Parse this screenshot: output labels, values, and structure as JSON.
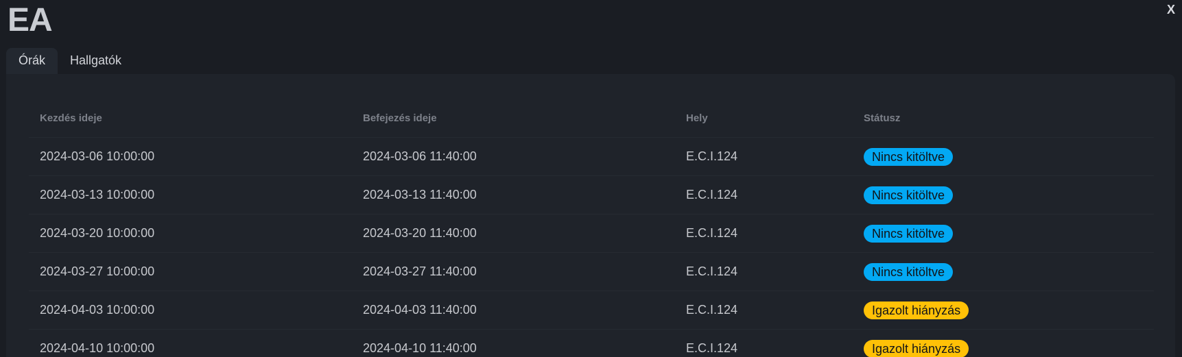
{
  "window": {
    "title": "EA",
    "close_label": "X"
  },
  "tabs": [
    {
      "label": "Órák",
      "active": true
    },
    {
      "label": "Hallgatók",
      "active": false
    }
  ],
  "table": {
    "headers": [
      "Kezdés ideje",
      "Befejezés ideje",
      "Hely",
      "Státusz"
    ],
    "rows": [
      {
        "start": "2024-03-06 10:00:00",
        "end": "2024-03-06 11:40:00",
        "place": "E.C.I.124",
        "status": "Nincs kitöltve",
        "status_color": "#03a9f4"
      },
      {
        "start": "2024-03-13 10:00:00",
        "end": "2024-03-13 11:40:00",
        "place": "E.C.I.124",
        "status": "Nincs kitöltve",
        "status_color": "#03a9f4"
      },
      {
        "start": "2024-03-20 10:00:00",
        "end": "2024-03-20 11:40:00",
        "place": "E.C.I.124",
        "status": "Nincs kitöltve",
        "status_color": "#03a9f4"
      },
      {
        "start": "2024-03-27 10:00:00",
        "end": "2024-03-27 11:40:00",
        "place": "E.C.I.124",
        "status": "Nincs kitöltve",
        "status_color": "#03a9f4"
      },
      {
        "start": "2024-04-03 10:00:00",
        "end": "2024-04-03 11:40:00",
        "place": "E.C.I.124",
        "status": "Igazolt hiányzás",
        "status_color": "#ffc107"
      },
      {
        "start": "2024-04-10 10:00:00",
        "end": "2024-04-10 11:40:00",
        "place": "E.C.I.124",
        "status": "Igazolt hiányzás",
        "status_color": "#ffc107"
      }
    ]
  }
}
